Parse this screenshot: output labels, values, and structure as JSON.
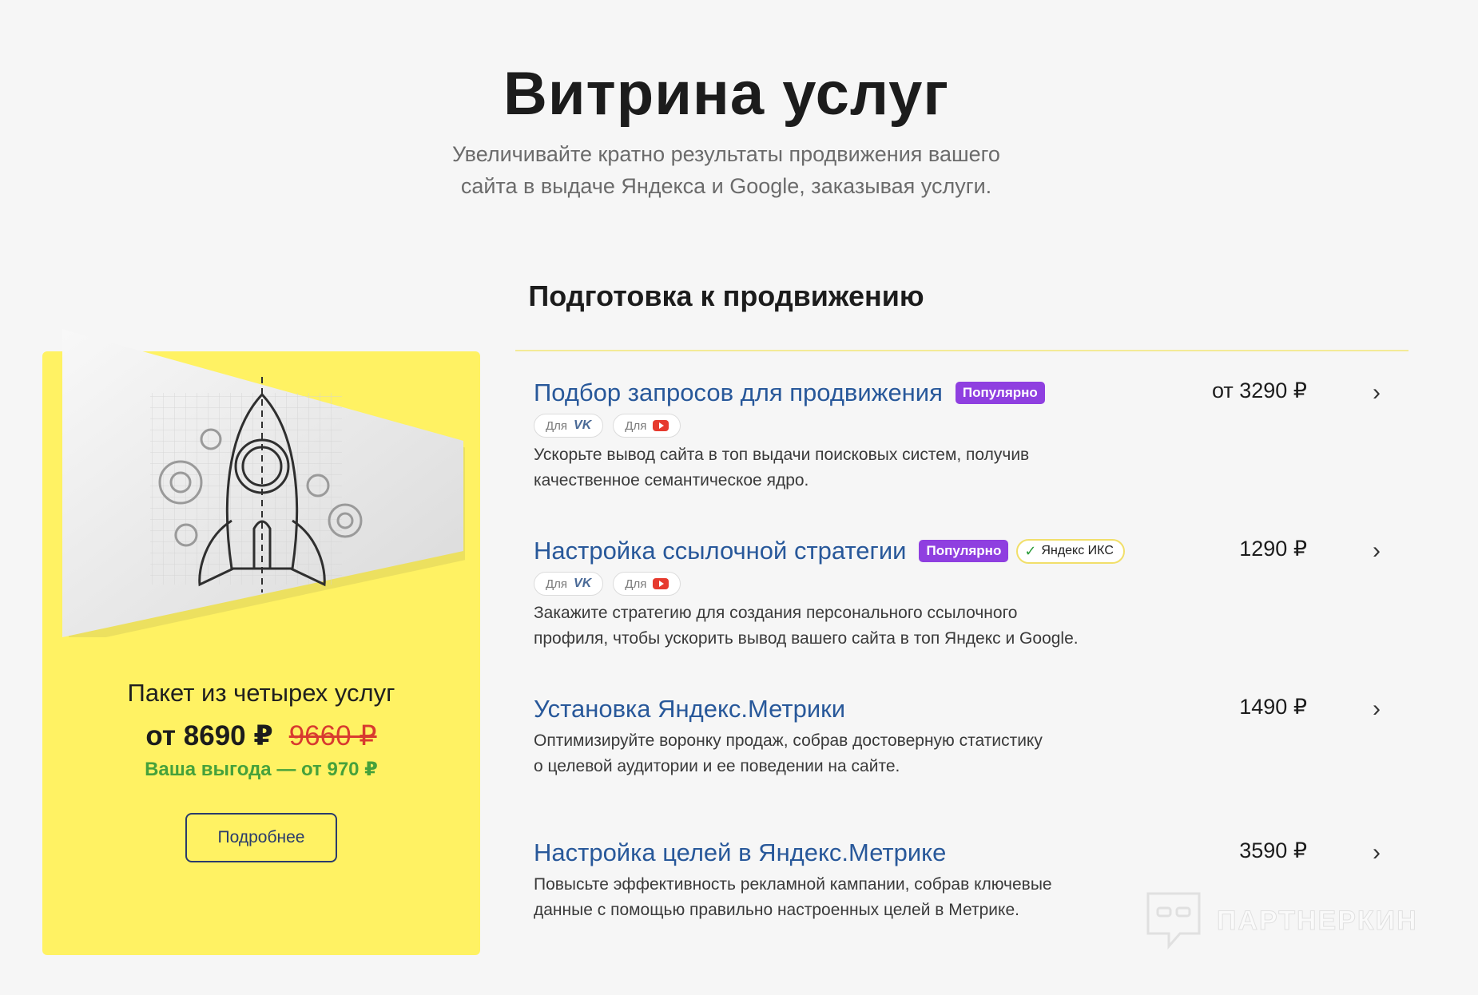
{
  "header": {
    "title": "Витрина услуг",
    "subtitle_line1": "Увеличивайте кратно результаты продвижения вашего",
    "subtitle_line2": "сайта в выдаче Яндекса и Google, заказывая услуги."
  },
  "section": {
    "title": "Подготовка к продвижению"
  },
  "promo": {
    "title": "Пакет из четырех услуг",
    "price": "от 8690 ₽",
    "old_price": "9660 ₽",
    "savings": "Ваша выгода — от 970 ₽",
    "button_label": "Подробнее",
    "background_color": "#fff263"
  },
  "tags": {
    "for_label": "Для",
    "vk_mark": "VK"
  },
  "services": [
    {
      "title": "Подбор запросов для продвижения",
      "badge": "Популярно",
      "price": "от 3290 ₽",
      "desc_line1": "Ускорьте вывод сайта в топ выдачи поисковых систем, получив",
      "desc_line2": "качественное семантическое ядро."
    },
    {
      "title": "Настройка ссылочной стратегии",
      "badge": "Популярно",
      "extra_badge": "Яндекс ИКС",
      "price": "1290 ₽",
      "desc_line1": "Закажите стратегию для создания персонального ссылочного",
      "desc_line2": "профиля, чтобы ускорить вывод вашего сайта в топ Яндекс и Google."
    },
    {
      "title": "Установка Яндекс.Метрики",
      "price": "1490 ₽",
      "desc_line1": "Оптимизируйте воронку продаж, собрав достоверную статистику",
      "desc_line2": "о целевой аудитории и ее поведении на сайте."
    },
    {
      "title": "Настройка целей в Яндекс.Метрике",
      "price": "3590 ₽",
      "desc_line1": "Повысьте эффективность рекламной кампании, собрав ключевые",
      "desc_line2": "данные с помощью правильно настроенных целей в Метрике."
    }
  ],
  "watermark": {
    "text": "ПАРТНЕРКИН"
  },
  "colors": {
    "link": "#28589a",
    "badge_popular": "#8f3fe0",
    "savings": "#46a13b",
    "old_price": "#d83b2f"
  }
}
